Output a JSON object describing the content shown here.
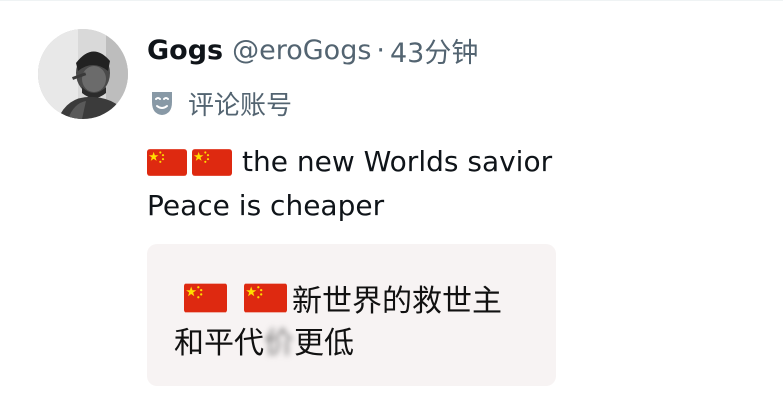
{
  "author": {
    "display_name": "Gogs",
    "handle": "@eroGogs",
    "separator": "·",
    "time_ago": "43分钟"
  },
  "badge": {
    "icon": "mask-icon",
    "label": "评论账号"
  },
  "tweet": {
    "line1_text": "the new Worlds savior",
    "line2_text": "Peace is cheaper",
    "flag_icon": "china-flag-icon"
  },
  "translation": {
    "line1_text": "新世界的救世主",
    "line2_before_blur": "和平代",
    "line2_blurred": "价",
    "line2_after_blur": "更低"
  },
  "colors": {
    "secondary_text": "#536471",
    "card_background": "#f7f3f3",
    "flag_red": "#de2910",
    "flag_star": "#ffde00"
  }
}
